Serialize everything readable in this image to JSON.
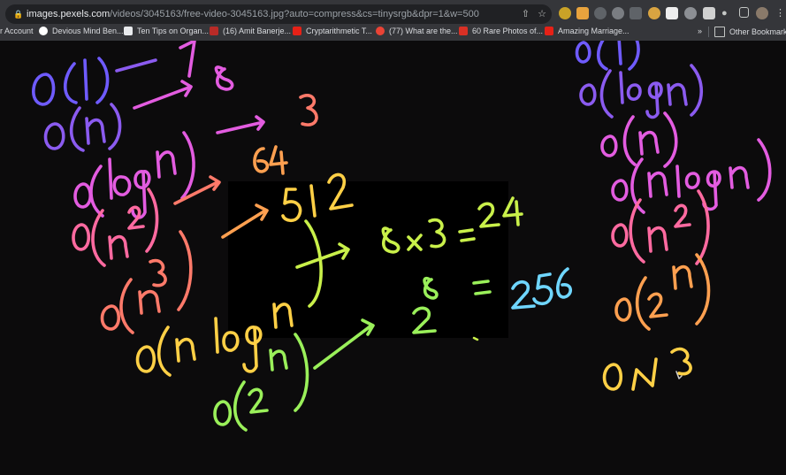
{
  "browser": {
    "url_host": "images.pexels.com",
    "url_path": "/videos/3045163/free-video-3045163.jpg?auto=compress&cs=tinysrgb&dpr=1&w=500",
    "bookmarks": [
      "r Account",
      "Devious Mind Ben...",
      "Ten Tips on Organ...",
      "(16) Amit Banerje...",
      "Cryptarithmetic T...",
      "(77) What are the...",
      "60 Rare Photos of...",
      "Amazing Marriage..."
    ],
    "overflow": "»",
    "other_bookmarks": "Other Bookmarks"
  },
  "colors": {
    "purple": "#6f5bff",
    "violet": "#8b5bf0",
    "magenta": "#e35ce0",
    "pink": "#ff6aa0",
    "salmon": "#ff7a6a",
    "orange": "#ffa050",
    "yellow": "#ffd046",
    "lime": "#c9f04a",
    "green": "#9af05a",
    "cyan": "#6fd6ff"
  }
}
